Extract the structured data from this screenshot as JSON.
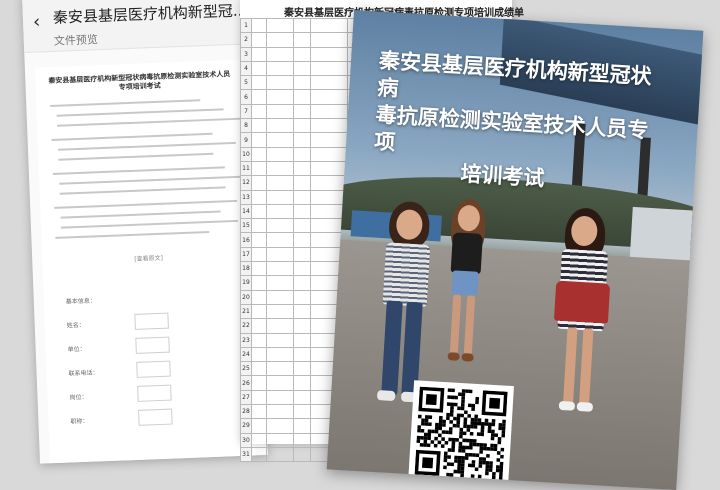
{
  "doc_preview": {
    "back_glyph": "‹",
    "title": "秦安县基层医疗机构新型冠...",
    "subtitle": "文件预览",
    "document_heading": "秦安县基层医疗机构新型冠状病毒抗原检测实验室技术人员专项培训考试",
    "link_text": "[查看原文]",
    "form_fields": [
      "基本信息：",
      "姓名：",
      "单位：",
      "联系电话：",
      "岗位：",
      "职称："
    ]
  },
  "sheet": {
    "title": "秦安县基层医疗机构新冠病毒抗原检测专项培训成绩单",
    "row_numbers": [
      "1",
      "2",
      "3",
      "4",
      "5",
      "6",
      "7",
      "8",
      "9",
      "10",
      "11",
      "12",
      "13",
      "14",
      "15",
      "16",
      "17",
      "18",
      "19",
      "20",
      "21",
      "22",
      "23",
      "24",
      "25",
      "26",
      "27",
      "28",
      "29",
      "30",
      "31"
    ]
  },
  "poster": {
    "title_line1": "秦安县基层医疗机构新型冠状病",
    "title_line2": "毒抗原检测实验室技术人员专项",
    "title_line3": "培训考试"
  },
  "colors": {
    "poster_sky": "#8aa7c2",
    "title_text": "#ffffff"
  }
}
